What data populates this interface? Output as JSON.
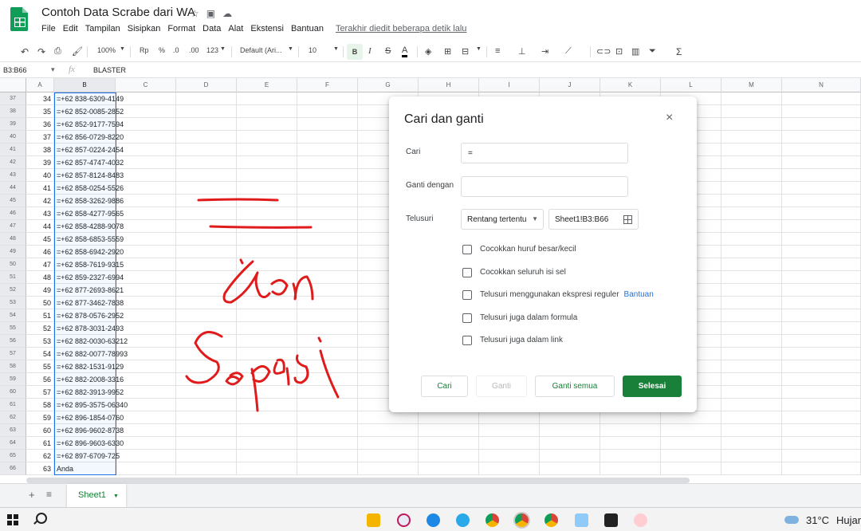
{
  "doc": {
    "title": "Contoh Data Scrabe dari WA",
    "menus": [
      "File",
      "Edit",
      "Tampilan",
      "Sisipkan",
      "Format",
      "Data",
      "Alat",
      "Ekstensi",
      "Bantuan"
    ],
    "last_edit": "Terakhir diedit beberapa detik lalu"
  },
  "toolbar": {
    "zoom": "100%",
    "currency": "Rp",
    "percent": "%",
    "dec_minus": ".0",
    "dec_plus": ".00",
    "numfmt": "123",
    "font": "Default (Ari...",
    "font_size": "10",
    "bold": "B",
    "italic": "I",
    "strike": "S",
    "textcolor": "A"
  },
  "formula": {
    "namebox": "B3:B66",
    "fx": "fx",
    "value": "BLASTER"
  },
  "columns": [
    "A",
    "B",
    "C",
    "D",
    "E",
    "F",
    "G",
    "H",
    "I",
    "J",
    "K",
    "L",
    "M",
    "N"
  ],
  "rows": [
    {
      "n": "37",
      "a": "34",
      "b": "=+62 838-6309-4149"
    },
    {
      "n": "38",
      "a": "35",
      "b": "=+62 852-0085-2852"
    },
    {
      "n": "39",
      "a": "36",
      "b": "=+62 852-9177-7594"
    },
    {
      "n": "40",
      "a": "37",
      "b": "=+62 856-0729-8220"
    },
    {
      "n": "41",
      "a": "38",
      "b": "=+62 857-0224-2454"
    },
    {
      "n": "42",
      "a": "39",
      "b": "=+62 857-4747-4032"
    },
    {
      "n": "43",
      "a": "40",
      "b": "=+62 857-8124-8483"
    },
    {
      "n": "44",
      "a": "41",
      "b": "=+62 858-0254-5526"
    },
    {
      "n": "45",
      "a": "42",
      "b": "=+62 858-3262-9886"
    },
    {
      "n": "46",
      "a": "43",
      "b": "=+62 858-4277-9565"
    },
    {
      "n": "47",
      "a": "44",
      "b": "=+62 858-4288-9078"
    },
    {
      "n": "48",
      "a": "45",
      "b": "=+62 858-6853-5559"
    },
    {
      "n": "49",
      "a": "46",
      "b": "=+62 858-6942-2920"
    },
    {
      "n": "50",
      "a": "47",
      "b": "=+62 858-7619-9315"
    },
    {
      "n": "51",
      "a": "48",
      "b": "=+62 859-2327-6994"
    },
    {
      "n": "52",
      "a": "49",
      "b": "=+62 877-2693-8621"
    },
    {
      "n": "53",
      "a": "50",
      "b": "=+62 877-3462-7838"
    },
    {
      "n": "54",
      "a": "51",
      "b": "=+62 878-0576-2952"
    },
    {
      "n": "55",
      "a": "52",
      "b": "=+62 878-3031-2493"
    },
    {
      "n": "56",
      "a": "53",
      "b": "=+62 882-0030-63212"
    },
    {
      "n": "57",
      "a": "54",
      "b": "=+62 882-0077-78993"
    },
    {
      "n": "58",
      "a": "55",
      "b": "=+62 882-1531-9129"
    },
    {
      "n": "59",
      "a": "56",
      "b": "=+62 882-2008-3316"
    },
    {
      "n": "60",
      "a": "57",
      "b": "=+62 882-3913-9952"
    },
    {
      "n": "61",
      "a": "58",
      "b": "=+62 895-3575-06340"
    },
    {
      "n": "62",
      "a": "59",
      "b": "=+62 896-1854-0760"
    },
    {
      "n": "63",
      "a": "60",
      "b": "=+62 896-9602-8738"
    },
    {
      "n": "64",
      "a": "61",
      "b": "=+62 896-9603-6330"
    },
    {
      "n": "65",
      "a": "62",
      "b": "=+62 897-6709-725"
    },
    {
      "n": "66",
      "a": "63",
      "b": "Anda"
    }
  ],
  "sheet": {
    "tab": "Sheet1",
    "add": "+",
    "list": "≡"
  },
  "dialog": {
    "title": "Cari dan ganti",
    "close": "×",
    "find_label": "Cari",
    "find_value": "=",
    "replace_label": "Ganti dengan",
    "replace_value": "",
    "search_label": "Telusuri",
    "search_scope": "Rentang tertentu",
    "range": "Sheet1!B3:B66",
    "options": [
      "Cocokkan huruf besar/kecil",
      "Cocokkan seluruh isi sel",
      "Telusuri menggunakan ekspresi reguler",
      "Telusuri juga dalam formula",
      "Telusuri juga dalam link"
    ],
    "help": "Bantuan",
    "btn_find": "Cari",
    "btn_replace": "Ganti",
    "btn_replace_all": "Ganti semua",
    "btn_done": "Selesai"
  },
  "taskbar": {
    "temp": "31°C",
    "weather": "Hujan"
  },
  "colors": {
    "accent": "#188038",
    "link": "#1a73e8",
    "ink": "#e01b1b"
  }
}
